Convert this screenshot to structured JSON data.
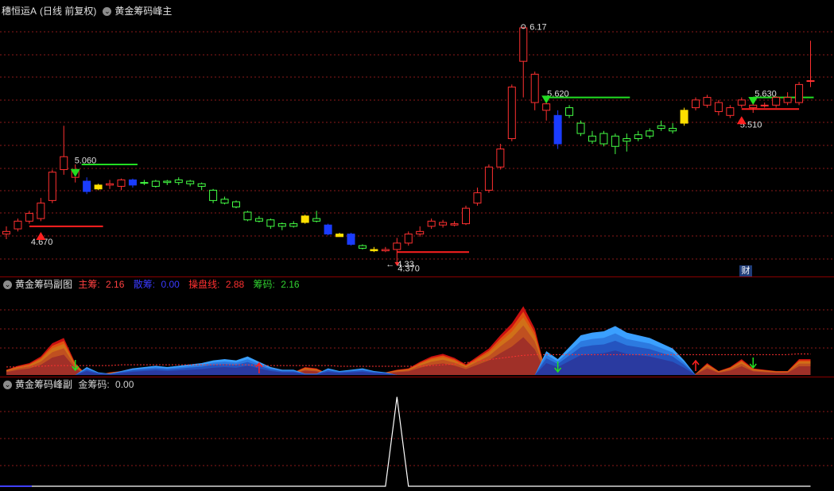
{
  "main": {
    "stock_name": "穗恒运A",
    "period": "(日线 前复权)",
    "indicator": "黄金筹码峰主",
    "labels": {
      "high": "6.17",
      "low_arrow": "← 4.33",
      "p5060": "5.060",
      "p4670": "4.670",
      "p4370": "4.370",
      "p5620": "5.620",
      "p5630": "5.630",
      "p5510": "5.510"
    },
    "finance_badge": "财"
  },
  "sub1": {
    "name": "黄金筹码副图",
    "items": [
      {
        "label": "主筹:",
        "value": "2.16",
        "color": "#ff4040"
      },
      {
        "label": "散筹:",
        "value": "0.00",
        "color": "#3030ff"
      },
      {
        "label": "操盘线:",
        "value": "2.88",
        "color": "#ff3030"
      },
      {
        "label": "筹码:",
        "value": "2.16",
        "color": "#30d030"
      }
    ]
  },
  "sub2": {
    "name": "黄金筹码峰副",
    "items": [
      {
        "label": "金筹码:",
        "value": "0.00",
        "color": "#d0d0d0"
      }
    ]
  },
  "colors": {
    "up": "#ff3030",
    "down_green": "#44ff44",
    "down_blue": "#1a3cff",
    "yellow": "#ffe000",
    "grid": "#8b1a1a",
    "support_green": "#22dd22",
    "support_red": "#ff2020"
  },
  "chart_data": {
    "type": "candlestick",
    "candles": [
      {
        "o": 4.56,
        "c": 4.58,
        "h": 4.62,
        "l": 4.52,
        "k": "up"
      },
      {
        "o": 4.6,
        "c": 4.66,
        "h": 4.68,
        "l": 4.58,
        "k": "up"
      },
      {
        "o": 4.66,
        "c": 4.72,
        "h": 4.74,
        "l": 4.64,
        "k": "up"
      },
      {
        "o": 4.68,
        "c": 4.8,
        "h": 4.84,
        "l": 4.66,
        "k": "up"
      },
      {
        "o": 4.82,
        "c": 5.04,
        "h": 5.06,
        "l": 4.8,
        "k": "up"
      },
      {
        "o": 5.06,
        "c": 5.16,
        "h": 5.4,
        "l": 5.02,
        "k": "up"
      },
      {
        "o": 5.06,
        "c": 5.0,
        "h": 5.1,
        "l": 4.96,
        "k": "up"
      },
      {
        "o": 4.97,
        "c": 4.89,
        "h": 5.0,
        "l": 4.87,
        "k": "blue"
      },
      {
        "o": 4.91,
        "c": 4.94,
        "h": 4.95,
        "l": 4.9,
        "k": "yellow"
      },
      {
        "o": 4.94,
        "c": 4.95,
        "h": 4.98,
        "l": 4.91,
        "k": "up"
      },
      {
        "o": 4.93,
        "c": 4.98,
        "h": 4.99,
        "l": 4.9,
        "k": "up"
      },
      {
        "o": 4.98,
        "c": 4.94,
        "h": 4.99,
        "l": 4.92,
        "k": "blue"
      },
      {
        "o": 4.96,
        "c": 4.96,
        "h": 4.98,
        "l": 4.94,
        "k": "green"
      },
      {
        "o": 4.97,
        "c": 4.93,
        "h": 4.98,
        "l": 4.92,
        "k": "green"
      },
      {
        "o": 4.96,
        "c": 4.97,
        "h": 4.98,
        "l": 4.94,
        "k": "green"
      },
      {
        "o": 4.96,
        "c": 4.98,
        "h": 5.0,
        "l": 4.94,
        "k": "green"
      },
      {
        "o": 4.97,
        "c": 4.95,
        "h": 4.98,
        "l": 4.93,
        "k": "green"
      },
      {
        "o": 4.95,
        "c": 4.93,
        "h": 4.96,
        "l": 4.9,
        "k": "green"
      },
      {
        "o": 4.9,
        "c": 4.82,
        "h": 4.91,
        "l": 4.8,
        "k": "green"
      },
      {
        "o": 4.83,
        "c": 4.8,
        "h": 4.85,
        "l": 4.79,
        "k": "green"
      },
      {
        "o": 4.81,
        "c": 4.77,
        "h": 4.82,
        "l": 4.76,
        "k": "green"
      },
      {
        "o": 4.73,
        "c": 4.67,
        "h": 4.74,
        "l": 4.66,
        "k": "green"
      },
      {
        "o": 4.68,
        "c": 4.66,
        "h": 4.7,
        "l": 4.65,
        "k": "green"
      },
      {
        "o": 4.67,
        "c": 4.62,
        "h": 4.68,
        "l": 4.6,
        "k": "green"
      },
      {
        "o": 4.62,
        "c": 4.64,
        "h": 4.65,
        "l": 4.59,
        "k": "green"
      },
      {
        "o": 4.64,
        "c": 4.62,
        "h": 4.66,
        "l": 4.61,
        "k": "green"
      },
      {
        "o": 4.65,
        "c": 4.7,
        "h": 4.71,
        "l": 4.64,
        "k": "yellow"
      },
      {
        "o": 4.68,
        "c": 4.66,
        "h": 4.74,
        "l": 4.65,
        "k": "green"
      },
      {
        "o": 4.63,
        "c": 4.56,
        "h": 4.64,
        "l": 4.55,
        "k": "blue"
      },
      {
        "o": 4.56,
        "c": 4.54,
        "h": 4.57,
        "l": 4.54,
        "k": "yellow"
      },
      {
        "o": 4.56,
        "c": 4.48,
        "h": 4.57,
        "l": 4.47,
        "k": "blue"
      },
      {
        "o": 4.47,
        "c": 4.45,
        "h": 4.48,
        "l": 4.44,
        "k": "green"
      },
      {
        "o": 4.44,
        "c": 4.43,
        "h": 4.46,
        "l": 4.42,
        "k": "yellow"
      },
      {
        "o": 4.44,
        "c": 4.43,
        "h": 4.46,
        "l": 4.42,
        "k": "up"
      },
      {
        "o": 4.44,
        "c": 4.49,
        "h": 4.53,
        "l": 4.33,
        "k": "up"
      },
      {
        "o": 4.49,
        "c": 4.56,
        "h": 4.58,
        "l": 4.47,
        "k": "up"
      },
      {
        "o": 4.56,
        "c": 4.58,
        "h": 4.62,
        "l": 4.54,
        "k": "up"
      },
      {
        "o": 4.62,
        "c": 4.66,
        "h": 4.68,
        "l": 4.6,
        "k": "up"
      },
      {
        "o": 4.63,
        "c": 4.65,
        "h": 4.67,
        "l": 4.61,
        "k": "up"
      },
      {
        "o": 4.63,
        "c": 4.64,
        "h": 4.66,
        "l": 4.62,
        "k": "up"
      },
      {
        "o": 4.64,
        "c": 4.76,
        "h": 4.78,
        "l": 4.63,
        "k": "up"
      },
      {
        "o": 4.8,
        "c": 4.88,
        "h": 4.92,
        "l": 4.78,
        "k": "up"
      },
      {
        "o": 4.9,
        "c": 5.08,
        "h": 5.1,
        "l": 4.88,
        "k": "up"
      },
      {
        "o": 5.08,
        "c": 5.22,
        "h": 5.26,
        "l": 5.06,
        "k": "up"
      },
      {
        "o": 5.3,
        "c": 5.7,
        "h": 5.72,
        "l": 5.28,
        "k": "up"
      },
      {
        "o": 5.9,
        "c": 6.16,
        "h": 6.17,
        "l": 5.62,
        "k": "up"
      },
      {
        "o": 5.8,
        "c": 5.58,
        "h": 5.82,
        "l": 5.52,
        "k": "up"
      },
      {
        "o": 5.57,
        "c": 5.52,
        "h": 5.6,
        "l": 5.44,
        "k": "up"
      },
      {
        "o": 5.48,
        "c": 5.26,
        "h": 5.52,
        "l": 5.22,
        "k": "blue"
      },
      {
        "o": 5.48,
        "c": 5.54,
        "h": 5.56,
        "l": 5.46,
        "k": "green"
      },
      {
        "o": 5.42,
        "c": 5.34,
        "h": 5.44,
        "l": 5.32,
        "k": "green"
      },
      {
        "o": 5.32,
        "c": 5.28,
        "h": 5.36,
        "l": 5.26,
        "k": "green"
      },
      {
        "o": 5.34,
        "c": 5.26,
        "h": 5.36,
        "l": 5.24,
        "k": "green"
      },
      {
        "o": 5.32,
        "c": 5.24,
        "h": 5.34,
        "l": 5.18,
        "k": "green"
      },
      {
        "o": 5.3,
        "c": 5.28,
        "h": 5.34,
        "l": 5.2,
        "k": "green"
      },
      {
        "o": 5.33,
        "c": 5.3,
        "h": 5.36,
        "l": 5.28,
        "k": "green"
      },
      {
        "o": 5.36,
        "c": 5.32,
        "h": 5.38,
        "l": 5.3,
        "k": "green"
      },
      {
        "o": 5.4,
        "c": 5.38,
        "h": 5.44,
        "l": 5.36,
        "k": "green"
      },
      {
        "o": 5.38,
        "c": 5.36,
        "h": 5.42,
        "l": 5.34,
        "k": "green"
      },
      {
        "o": 5.42,
        "c": 5.52,
        "h": 5.54,
        "l": 5.4,
        "k": "yellow"
      },
      {
        "o": 5.54,
        "c": 5.6,
        "h": 5.62,
        "l": 5.52,
        "k": "up"
      },
      {
        "o": 5.62,
        "c": 5.56,
        "h": 5.64,
        "l": 5.54,
        "k": "up"
      },
      {
        "o": 5.58,
        "c": 5.51,
        "h": 5.6,
        "l": 5.48,
        "k": "up"
      },
      {
        "o": 5.48,
        "c": 5.54,
        "h": 5.56,
        "l": 5.46,
        "k": "up"
      },
      {
        "o": 5.56,
        "c": 5.6,
        "h": 5.62,
        "l": 5.54,
        "k": "up"
      },
      {
        "o": 5.56,
        "c": 5.54,
        "h": 5.58,
        "l": 5.5,
        "k": "up"
      },
      {
        "o": 5.56,
        "c": 5.56,
        "h": 5.58,
        "l": 5.54,
        "k": "up"
      },
      {
        "o": 5.56,
        "c": 5.62,
        "h": 5.63,
        "l": 5.54,
        "k": "up"
      },
      {
        "o": 5.62,
        "c": 5.58,
        "h": 5.66,
        "l": 5.56,
        "k": "up"
      },
      {
        "o": 5.58,
        "c": 5.72,
        "h": 5.74,
        "l": 5.56,
        "k": "up"
      },
      {
        "o": 5.75,
        "c": 5.75,
        "h": 6.06,
        "l": 5.7,
        "k": "up"
      }
    ],
    "ylim": [
      4.28,
      6.24
    ],
    "main_chip": [
      0.4,
      0.7,
      0.9,
      1.4,
      2.4,
      2.8,
      0.9,
      0.0,
      0.0,
      0.2,
      0.3,
      0.5,
      0.5,
      0.3,
      0.1,
      0.2,
      0.3,
      0.2,
      0.4,
      0.4,
      0.6,
      0.7,
      0.7,
      0.6,
      0.4,
      0.2,
      0.6,
      0.5,
      0.1,
      0.1,
      0.0,
      0.1,
      0.1,
      0.2,
      0.4,
      0.5,
      1.0,
      1.4,
      1.6,
      1.3,
      0.8,
      1.4,
      2.0,
      3.0,
      3.9,
      5.2,
      3.5,
      0.1,
      0.0,
      0.0,
      0.0,
      0.0,
      0.0,
      0.0,
      0.0,
      0.0,
      0.0,
      0.0,
      0.0,
      0.0,
      0.1,
      0.9,
      0.3,
      0.6,
      1.2,
      0.5,
      0.4,
      0.3,
      0.3,
      1.2,
      1.2
    ],
    "scatter_chip": [
      0.0,
      0.0,
      0.0,
      0.0,
      0.0,
      0.0,
      0.0,
      0.6,
      0.2,
      0.1,
      0.3,
      0.5,
      0.6,
      0.7,
      0.6,
      0.7,
      0.8,
      0.9,
      1.1,
      1.2,
      1.1,
      1.4,
      1.0,
      0.6,
      0.4,
      0.4,
      0.1,
      0.1,
      0.5,
      0.3,
      0.4,
      0.5,
      0.3,
      0.2,
      0.0,
      0.0,
      0.0,
      0.0,
      0.0,
      0.0,
      0.0,
      0.0,
      0.0,
      0.0,
      0.0,
      0.0,
      0.0,
      1.8,
      1.2,
      2.1,
      3.0,
      3.2,
      3.3,
      3.7,
      3.2,
      3.0,
      2.8,
      2.4,
      2.0,
      1.1,
      0.0,
      0.0,
      0.0,
      0.0,
      0.0,
      0.0,
      0.0,
      0.0,
      0.0,
      0.0,
      0.0
    ],
    "operate_line": [
      1.1,
      1.1,
      1.2,
      1.2,
      1.3,
      1.3,
      1.3,
      1.3,
      1.3,
      1.3,
      1.4,
      1.4,
      1.4,
      1.4,
      1.4,
      1.4,
      1.4,
      1.4,
      1.4,
      1.4,
      1.4,
      1.4,
      1.3,
      1.3,
      1.3,
      1.3,
      1.3,
      1.3,
      1.3,
      1.2,
      1.2,
      1.2,
      1.2,
      1.2,
      1.2,
      1.2,
      1.2,
      1.3,
      1.4,
      1.5,
      1.7,
      1.9,
      2.1,
      2.3,
      2.5,
      2.7,
      2.8,
      2.8,
      2.8,
      2.8,
      2.8,
      2.8,
      2.8,
      2.8,
      2.8,
      2.8,
      2.8,
      2.8,
      2.8,
      2.8,
      2.8,
      2.8,
      2.8,
      2.8,
      2.8,
      2.8,
      2.8,
      2.8,
      2.8,
      2.9,
      2.88
    ],
    "sub1_ylim": [
      0,
      6.0
    ],
    "gold_chip": [
      0,
      0,
      0,
      0,
      0,
      0,
      0,
      0,
      0,
      0,
      0,
      0,
      0,
      0,
      0,
      0,
      0,
      0,
      0,
      0,
      0,
      0,
      0,
      0,
      0,
      0,
      0,
      0,
      0,
      0,
      0,
      0,
      0,
      0,
      1,
      0,
      0,
      0,
      0,
      0,
      0,
      0,
      0,
      0,
      0,
      0,
      0,
      0,
      0,
      0,
      0,
      0,
      0,
      0,
      0,
      0,
      0,
      0,
      0,
      0,
      0,
      0,
      0,
      0,
      0,
      0,
      0,
      0,
      0,
      0,
      0
    ],
    "sub2_ylim": [
      0,
      1.05
    ]
  }
}
